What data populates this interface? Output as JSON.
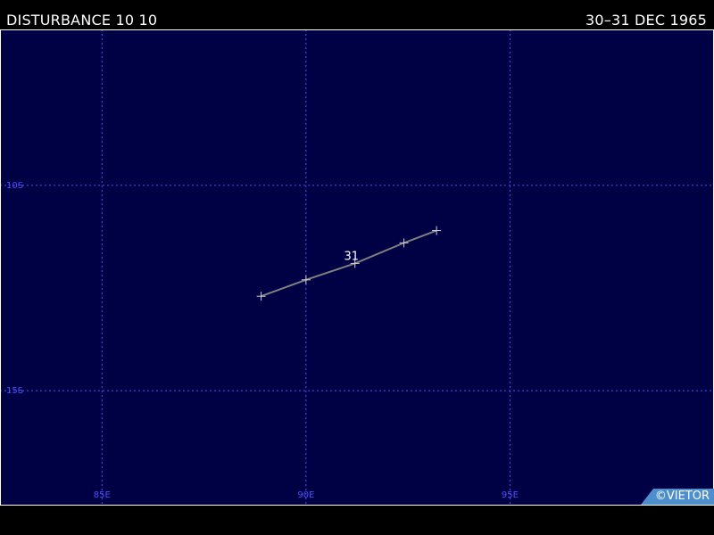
{
  "header": {
    "title": "DISTURBANCE 10 10",
    "date_range": "30–31 DEC 1965"
  },
  "map": {
    "lon_range": [
      82.5,
      100
    ],
    "lat_range_south": [
      6.2,
      17.8
    ],
    "background_color": "#000044",
    "grid_color": "#5050ff",
    "track_color": "#808080",
    "lon_grid": [
      {
        "value": 85,
        "label": "85E"
      },
      {
        "value": 90,
        "label": "90E"
      },
      {
        "value": 95,
        "label": "95E"
      }
    ],
    "lat_grid": [
      {
        "value": 10,
        "label": "10S"
      },
      {
        "value": 15,
        "label": "15S"
      }
    ],
    "track_points": [
      {
        "lon": 88.9,
        "lat": 12.7
      },
      {
        "lon": 90.0,
        "lat": 12.3
      },
      {
        "lon": 91.2,
        "lat": 11.9
      },
      {
        "lon": 92.4,
        "lat": 11.4
      },
      {
        "lon": 93.2,
        "lat": 11.1
      }
    ],
    "day_markers": [
      {
        "label": "31",
        "lon": 91.2,
        "lat": 11.9
      }
    ]
  },
  "credit": "©VIETOR"
}
